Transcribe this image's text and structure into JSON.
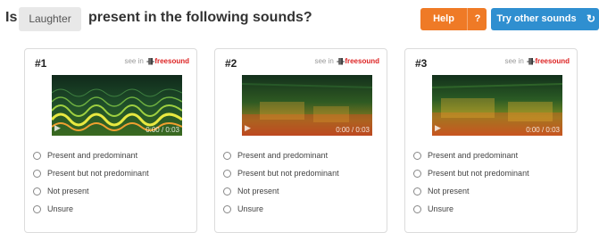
{
  "question": {
    "prefix": "Is",
    "tag": "Laughter",
    "suffix": "present in the following sounds?"
  },
  "toolbar": {
    "help_label": "Help",
    "help_question": "?",
    "try_label": "Try other sounds",
    "refresh_icon": "refresh-icon"
  },
  "colors": {
    "help_button": "#ef7a26",
    "try_button": "#2f8fd0",
    "freesound_red": "#dd2222"
  },
  "cards": [
    {
      "number": "#1",
      "see_in": "see in",
      "brand": "freesound",
      "time": "0:00 / 0:03",
      "options": [
        "Present and predominant",
        "Present but not predominant",
        "Not present",
        "Unsure"
      ]
    },
    {
      "number": "#2",
      "see_in": "see in",
      "brand": "freesound",
      "time": "0:00 / 0:03",
      "options": [
        "Present and predominant",
        "Present but not predominant",
        "Not present",
        "Unsure"
      ]
    },
    {
      "number": "#3",
      "see_in": "see in",
      "brand": "freesound",
      "time": "0:00 / 0:03",
      "options": [
        "Present and predominant",
        "Present but not predominant",
        "Not present",
        "Unsure"
      ]
    }
  ]
}
